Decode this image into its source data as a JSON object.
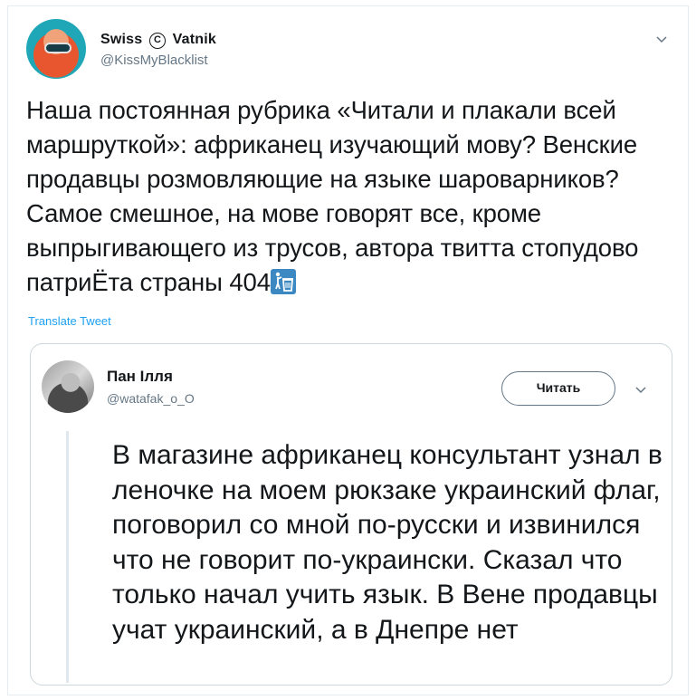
{
  "tweet": {
    "author": {
      "name_part1": "Swiss",
      "copyright_symbol": "C",
      "name_part2": "Vatnik",
      "handle": "@KissMyBlacklist"
    },
    "text": "Наша постоянная рубрика «Читали и плакали всей маршруткой»: африканец изучающий мову? Венские продавцы розмовляющие на языке шароварников? Самое смешное, на мове говорят все, кроме выпрыгивающего из трусов, автора твитта стопудово патриЁта страны 404",
    "emoji": "wastebasket-person-icon",
    "translate_label": "Translate Tweet"
  },
  "quoted_tweet": {
    "author": {
      "name": "Пан Ілля",
      "handle": "@watafak_o_O"
    },
    "follow_label": "Читать",
    "text": "В магазине африканец консультант узнал в леночке на моем рюкзаке украинский флаг, поговорил со мной по-русски и извинился что не говорит по-украински. Сказал что только начал учить язык. В Вене продавцы учат украинский, а в Днепре нет"
  },
  "colors": {
    "link": "#1da1f2",
    "secondary_text": "#657786",
    "border": "#e6ecf0",
    "quote_border": "#ccd6dd",
    "emoji_bg": "#3b88c3"
  }
}
